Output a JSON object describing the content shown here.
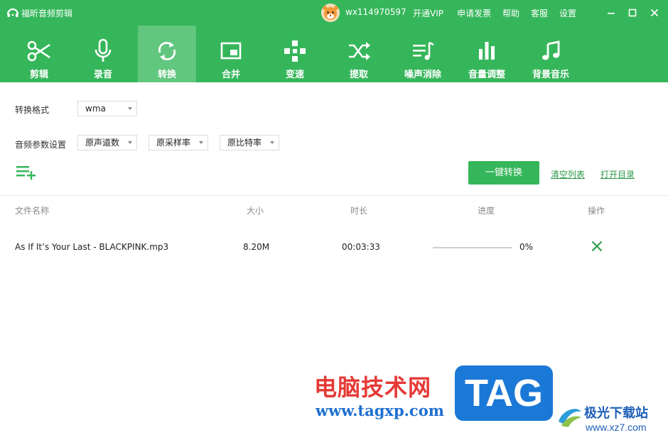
{
  "app": {
    "title": "福昕音频剪辑",
    "username": "wx114970597",
    "top_links": [
      "开通VIP",
      "申请发票",
      "帮助",
      "客服",
      "设置"
    ],
    "accent_color": "#35b65a"
  },
  "toolbar": {
    "items": [
      {
        "label": "剪辑",
        "icon": "scissors-icon"
      },
      {
        "label": "录音",
        "icon": "microphone-icon"
      },
      {
        "label": "转换",
        "icon": "refresh-icon",
        "active": true
      },
      {
        "label": "合并",
        "icon": "picture-in-picture-icon"
      },
      {
        "label": "变速",
        "icon": "gamepad-icon"
      },
      {
        "label": "提取",
        "icon": "shuffle-icon"
      },
      {
        "label": "噪声消除",
        "icon": "playlist-icon"
      },
      {
        "label": "音量调整",
        "icon": "bar-chart-icon"
      },
      {
        "label": "背景音乐",
        "icon": "music-note-icon"
      }
    ]
  },
  "settings": {
    "format_label": "转换格式",
    "format_value": "wma",
    "params_label": "音频参数设置",
    "channels_value": "原声道数",
    "samplerate_value": "原采样率",
    "bitrate_value": "原比特率"
  },
  "actions": {
    "convert_label": "一键转换",
    "clear_label": "清空列表",
    "open_dir_label": "打开目录"
  },
  "table": {
    "headers": [
      "文件名称",
      "大小",
      "时长",
      "进度",
      "操作"
    ],
    "rows": [
      {
        "name": "As If It’s Your Last - BLACKPINK.mp3",
        "size": "8.20M",
        "duration": "00:03:33",
        "progress_text": "0%",
        "progress": 0
      }
    ]
  },
  "watermark": {
    "cn": "电脑技术网",
    "url": "www.tagxp.com",
    "tag": "TAG",
    "jg_text": "极光下载站",
    "jg_url": "www.xz7.com"
  }
}
